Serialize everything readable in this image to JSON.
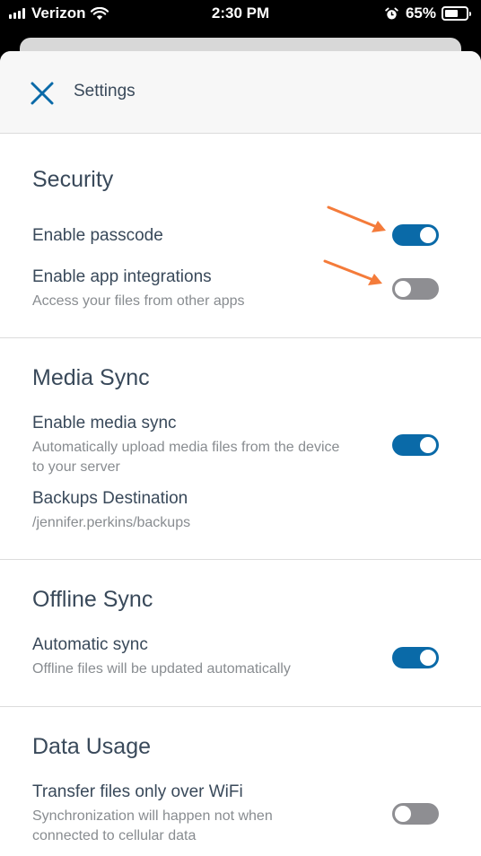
{
  "status_bar": {
    "carrier": "Verizon",
    "time": "2:30 PM",
    "battery": "65%",
    "battery_level": 0.65,
    "icons": [
      "signal-icon",
      "wifi-icon",
      "alarm-icon",
      "battery-icon"
    ]
  },
  "header": {
    "title": "Settings",
    "close_icon": "close-icon"
  },
  "sections": {
    "security": {
      "title": "Security",
      "passcode": {
        "label": "Enable passcode",
        "on": true
      },
      "integrations": {
        "label": "Enable app integrations",
        "description": "Access your files from other apps",
        "on": false
      }
    },
    "media_sync": {
      "title": "Media Sync",
      "enable": {
        "label": "Enable media sync",
        "description": "Automatically upload media files from the device to your server",
        "on": true
      },
      "backups": {
        "label": "Backups Destination",
        "value": "/jennifer.perkins/backups"
      }
    },
    "offline_sync": {
      "title": "Offline Sync",
      "automatic": {
        "label": "Automatic sync",
        "description": "Offline files will be updated automatically",
        "on": true
      }
    },
    "data_usage": {
      "title": "Data Usage",
      "wifi_only": {
        "label": "Transfer files only over WiFi",
        "description": "Synchronization will happen not when connected to cellular data",
        "on": false
      }
    }
  },
  "colors": {
    "toggle_on": "#0a6aa8",
    "toggle_off": "#8e8e92",
    "text_primary": "#39495a",
    "text_secondary": "#888c90",
    "annotation_arrow": "#f47b3a"
  }
}
